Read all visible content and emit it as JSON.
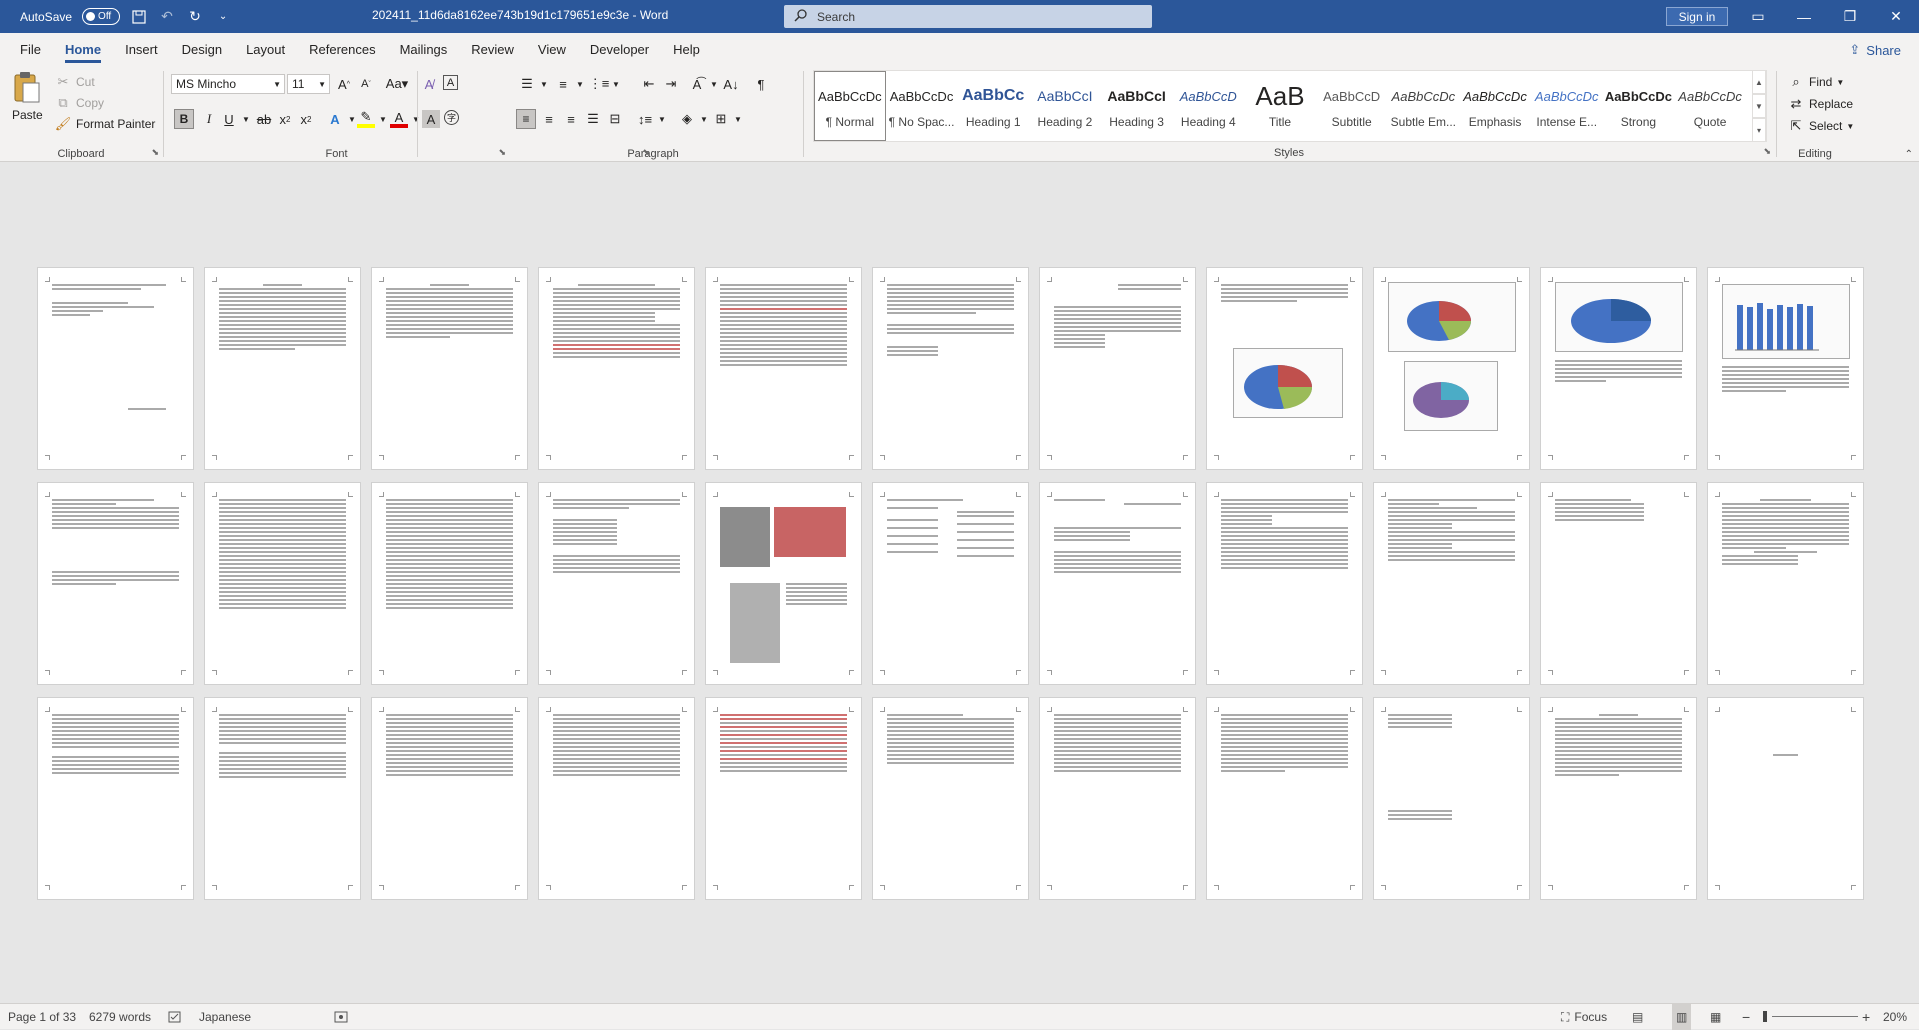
{
  "titlebar": {
    "autosave_label": "AutoSave",
    "autosave_state": "Off",
    "doc_title": "202411_11d6da8162ee743b19d1c179651e9c3e  -  Word",
    "search_placeholder": "Search",
    "signin_label": "Sign in"
  },
  "menu": {
    "tabs": [
      "File",
      "Home",
      "Insert",
      "Design",
      "Layout",
      "References",
      "Mailings",
      "Review",
      "View",
      "Developer",
      "Help"
    ],
    "active_tab": "Home",
    "share_label": "Share"
  },
  "ribbon": {
    "clipboard": {
      "label": "Clipboard",
      "paste": "Paste",
      "cut": "Cut",
      "copy": "Copy",
      "format_painter": "Format Painter"
    },
    "font": {
      "label": "Font",
      "font_name": "MS Mincho",
      "font_size": "11"
    },
    "paragraph": {
      "label": "Paragraph"
    },
    "styles": {
      "label": "Styles",
      "items": [
        {
          "sample": "AaBbCcDc",
          "name": "¶ Normal"
        },
        {
          "sample": "AaBbCcDc",
          "name": "¶ No Spac..."
        },
        {
          "sample": "AaBbCc",
          "name": "Heading 1"
        },
        {
          "sample": "AaBbCcI",
          "name": "Heading 2"
        },
        {
          "sample": "AaBbCcI",
          "name": "Heading 3"
        },
        {
          "sample": "AaBbCcD",
          "name": "Heading 4"
        },
        {
          "sample": "AaB",
          "name": "Title"
        },
        {
          "sample": "AaBbCcD",
          "name": "Subtitle"
        },
        {
          "sample": "AaBbCcDc",
          "name": "Subtle Em..."
        },
        {
          "sample": "AaBbCcDc",
          "name": "Emphasis"
        },
        {
          "sample": "AaBbCcDc",
          "name": "Intense E..."
        },
        {
          "sample": "AaBbCcDc",
          "name": "Strong"
        },
        {
          "sample": "AaBbCcDc",
          "name": "Quote"
        }
      ]
    },
    "editing": {
      "label": "Editing",
      "find": "Find",
      "replace": "Replace",
      "select": "Select"
    }
  },
  "status": {
    "page": "Page 1 of 33",
    "words": "6279 words",
    "language": "Japanese",
    "focus": "Focus",
    "zoom": "20%"
  },
  "colors": {
    "titlebar": "#2b579a",
    "accent": "#2b579a",
    "ribbon_bg": "#f3f2f1",
    "doc_bg": "#e6e6e6"
  }
}
